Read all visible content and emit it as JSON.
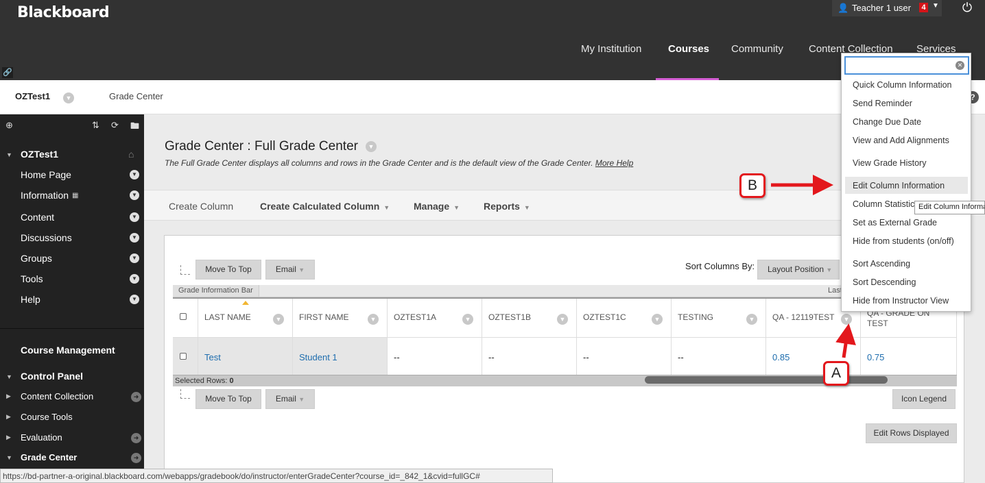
{
  "header": {
    "logo": "Blackboard",
    "user_name": "Teacher 1 user",
    "notification_count": "4",
    "nav_tabs": [
      "My Institution",
      "Courses",
      "Community",
      "Content Collection",
      "Services"
    ]
  },
  "breadcrumb": {
    "course": "OZTest1",
    "page": "Grade Center"
  },
  "sidebar": {
    "course_title": "OZTest1",
    "items": [
      "Home Page",
      "Information",
      "Content",
      "Discussions",
      "Groups",
      "Tools",
      "Help"
    ],
    "management_title": "Course Management",
    "control_panel": "Control Panel",
    "cp_items": [
      "Content Collection",
      "Course Tools",
      "Evaluation",
      "Grade Center"
    ]
  },
  "main": {
    "title": "Grade Center : Full Grade Center",
    "description": "The Full Grade Center displays all columns and rows in the Grade Center and is the default view of the Grade Center.",
    "more_help": "More Help",
    "actions": [
      "Create Column",
      "Create Calculated Column",
      "Manage",
      "Reports"
    ]
  },
  "grid": {
    "move_to_top": "Move To Top",
    "email": "Email",
    "sort_label": "Sort Columns By:",
    "sort_value": "Layout Position",
    "info_bar": "Grade Information Bar",
    "info_bar_right": "Last",
    "columns": [
      "LAST NAME",
      "FIRST NAME",
      "OZTEST1A",
      "OZTEST1B",
      "OZTEST1C",
      "TESTING",
      "QA - 12119TEST",
      "QA - GRADE ON TEST"
    ],
    "row": [
      "Test",
      "Student 1",
      "--",
      "--",
      "--",
      "--",
      "0.85",
      "0.75"
    ],
    "selected_rows_label": "Selected Rows:",
    "selected_rows_count": "0",
    "icon_legend": "Icon Legend",
    "edit_rows": "Edit Rows Displayed"
  },
  "menu": {
    "items": [
      "Quick Column Information",
      "Send Reminder",
      "Change Due Date",
      "View and Add Alignments",
      "View Grade History",
      "Edit Column Information",
      "Column Statistics",
      "Set as External Grade",
      "Hide from students (on/off)",
      "Sort Ascending",
      "Sort Descending",
      "Hide from Instructor View"
    ],
    "tooltip": "Edit Column Information"
  },
  "callouts": {
    "a": "A",
    "b": "B"
  },
  "status_url": "https://bd-partner-a-original.blackboard.com/webapps/gradebook/do/instructor/enterGradeCenter?course_id=_842_1&cvid=fullGC#",
  "colors": {
    "header_bg": "#323232",
    "accent_tab": "#d45dd4",
    "callout_red": "#e3171c",
    "link": "#1e6dae",
    "badge": "#d41419"
  }
}
